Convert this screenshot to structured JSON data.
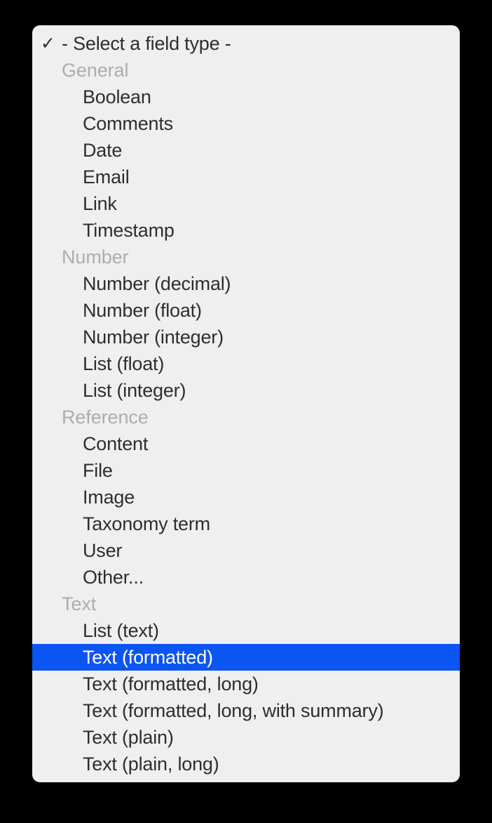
{
  "menu": {
    "title": {
      "label": "- Select a field type -",
      "check_icon": "✓",
      "checked": true
    },
    "selected_value": "Text (formatted)",
    "highlight_color": "#0b55f2",
    "panel_color": "#efefef",
    "group_label_color": "#adadad",
    "item_text_color": "#2e2e2e",
    "rows": [
      {
        "kind": "group",
        "label": "General"
      },
      {
        "kind": "item",
        "label": "Boolean"
      },
      {
        "kind": "item",
        "label": "Comments"
      },
      {
        "kind": "item",
        "label": "Date"
      },
      {
        "kind": "item",
        "label": "Email"
      },
      {
        "kind": "item",
        "label": "Link"
      },
      {
        "kind": "item",
        "label": "Timestamp"
      },
      {
        "kind": "group",
        "label": "Number"
      },
      {
        "kind": "item",
        "label": "Number (decimal)"
      },
      {
        "kind": "item",
        "label": "Number (float)"
      },
      {
        "kind": "item",
        "label": "Number (integer)"
      },
      {
        "kind": "item",
        "label": "List (float)"
      },
      {
        "kind": "item",
        "label": "List (integer)"
      },
      {
        "kind": "group",
        "label": "Reference"
      },
      {
        "kind": "item",
        "label": "Content"
      },
      {
        "kind": "item",
        "label": "File"
      },
      {
        "kind": "item",
        "label": "Image"
      },
      {
        "kind": "item",
        "label": "Taxonomy term"
      },
      {
        "kind": "item",
        "label": "User"
      },
      {
        "kind": "item",
        "label": "Other..."
      },
      {
        "kind": "group",
        "label": "Text"
      },
      {
        "kind": "item",
        "label": "List (text)"
      },
      {
        "kind": "item",
        "label": "Text (formatted)",
        "selected": true
      },
      {
        "kind": "item",
        "label": "Text (formatted, long)"
      },
      {
        "kind": "item",
        "label": "Text (formatted, long, with summary)"
      },
      {
        "kind": "item",
        "label": "Text (plain)"
      },
      {
        "kind": "item",
        "label": "Text (plain, long)"
      }
    ]
  }
}
